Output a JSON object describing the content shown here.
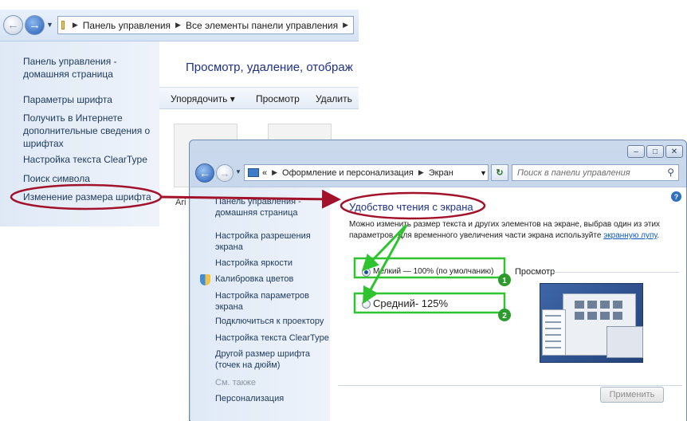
{
  "background_window": {
    "breadcrumbs": [
      "Панель управления",
      "Все элементы панели управления"
    ],
    "sidebar": [
      "Панель управления - домашняя страница",
      "Параметры шрифта",
      "Получить в Интернете дополнительные сведения о шрифтах",
      "Настройка текста ClearType",
      "Поиск символа",
      "Изменение размера шрифта"
    ],
    "heading": "Просмотр, удаление, отображ",
    "toolbar": {
      "organize": "Упорядочить",
      "view": "Просмотр",
      "delete": "Удалить"
    },
    "partial_item_text": "Ari"
  },
  "foreground_window": {
    "breadcrumb_prefix": "«",
    "breadcrumbs": [
      "Оформление и персонализация",
      "Экран"
    ],
    "search_placeholder": "Поиск в панели управления",
    "sidebar": [
      "Панель управления - домашняя страница",
      "Настройка разрешения экрана",
      "Настройка яркости",
      "Калибровка цветов",
      "Настройка параметров экрана",
      "Подключиться к проектору",
      "Настройка текста ClearType",
      "Другой размер шрифта (точек на дюйм)"
    ],
    "see_also_heading": "См. также",
    "see_also": [
      "Персонализация"
    ],
    "title": "Удобство чтения с экрана",
    "description": "Можно изменить размер текста и других элементов на экране, выбрав один из этих параметров. Для временного увеличения части экрана используйте",
    "description_link": "экранную лупу",
    "description_end": ".",
    "options": {
      "small": "Мелкий — 100% (по умолчанию)",
      "medium": "Средний- 125%"
    },
    "preview_label": "Просмотр",
    "apply_button": "Применить"
  },
  "annotations": {
    "badges": [
      "1",
      "2"
    ],
    "colors": {
      "arrow_red": "#a3122b",
      "ellipse_red": "#a3122b",
      "highlight_green": "#2fc42f",
      "badge_green": "#2b9b2b"
    }
  }
}
